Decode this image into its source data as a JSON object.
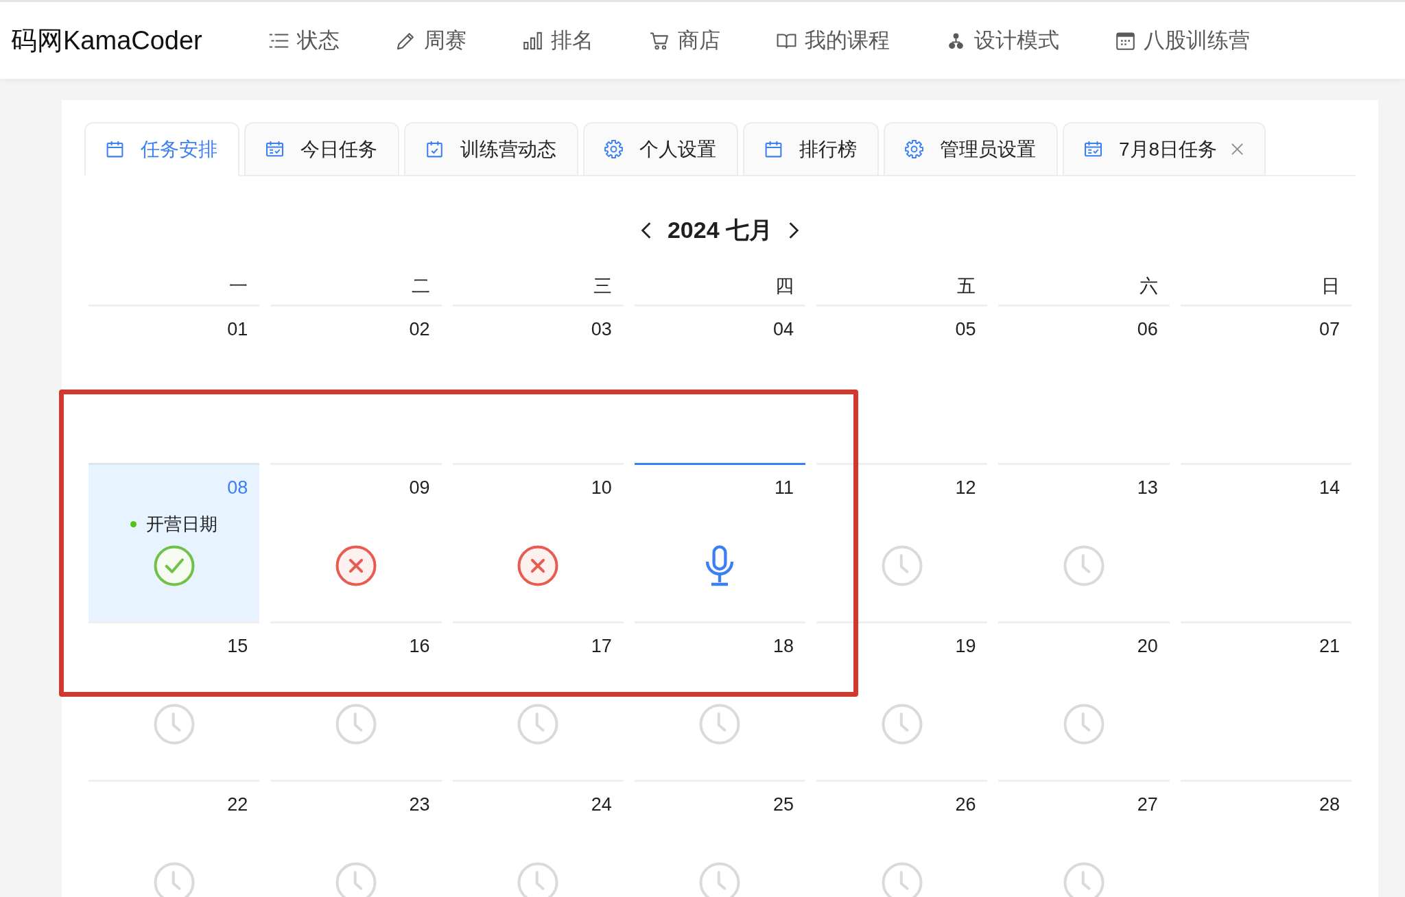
{
  "nav": {
    "logo": "码网KamaCoder",
    "items": [
      {
        "label": "状态",
        "kind": "list",
        "selected": false
      },
      {
        "label": "周赛",
        "kind": "edit",
        "selected": false
      },
      {
        "label": "排名",
        "kind": "chart",
        "selected": false
      },
      {
        "label": "商店",
        "kind": "cart",
        "selected": false
      },
      {
        "label": "我的课程",
        "kind": "book",
        "selected": false
      },
      {
        "label": "设计模式",
        "kind": "cluster",
        "selected": false
      },
      {
        "label": "八股训练营",
        "kind": "calendar",
        "selected": false
      }
    ]
  },
  "tabs": [
    {
      "label": "任务安排",
      "kind": "calendar",
      "selected": true,
      "closable": false
    },
    {
      "label": "今日任务",
      "kind": "schedule",
      "selected": false,
      "closable": false
    },
    {
      "label": "训练营动态",
      "kind": "check",
      "selected": false,
      "closable": false
    },
    {
      "label": "个人设置",
      "kind": "settings",
      "selected": false,
      "closable": false
    },
    {
      "label": "排行榜",
      "kind": "calendar",
      "selected": false,
      "closable": false
    },
    {
      "label": "管理员设置",
      "kind": "settings",
      "selected": false,
      "closable": false
    },
    {
      "label": "7月8日任务",
      "kind": "schedule",
      "selected": false,
      "closable": true
    }
  ],
  "calendar": {
    "title": "2024 七月",
    "weekdays": [
      "一",
      "二",
      "三",
      "四",
      "五",
      "六",
      "日"
    ],
    "weeks": [
      [
        {
          "day": "01",
          "selected": false
        },
        {
          "day": "02",
          "selected": false
        },
        {
          "day": "03",
          "selected": false
        },
        {
          "day": "04",
          "selected": false
        },
        {
          "day": "05",
          "selected": false
        },
        {
          "day": "06",
          "selected": false
        },
        {
          "day": "07",
          "selected": false
        }
      ],
      [
        {
          "day": "08",
          "selected": true,
          "kind": "done",
          "events": [
            {
              "text": "开营日期",
              "color": "#52c41a"
            }
          ]
        },
        {
          "day": "09",
          "selected": false,
          "kind": "missed"
        },
        {
          "day": "10",
          "selected": false,
          "kind": "missed"
        },
        {
          "day": "11",
          "selected": false,
          "kind": "current"
        },
        {
          "day": "12",
          "selected": false,
          "kind": "upcoming"
        },
        {
          "day": "13",
          "selected": false,
          "kind": "upcoming"
        },
        {
          "day": "14",
          "selected": false
        }
      ],
      [
        {
          "day": "15",
          "selected": false,
          "kind": "upcoming"
        },
        {
          "day": "16",
          "selected": false,
          "kind": "upcoming"
        },
        {
          "day": "17",
          "selected": false,
          "kind": "upcoming"
        },
        {
          "day": "18",
          "selected": false,
          "kind": "upcoming"
        },
        {
          "day": "19",
          "selected": false,
          "kind": "upcoming"
        },
        {
          "day": "20",
          "selected": false,
          "kind": "upcoming"
        },
        {
          "day": "21",
          "selected": false
        }
      ],
      [
        {
          "day": "22",
          "selected": false,
          "kind": "upcoming"
        },
        {
          "day": "23",
          "selected": false,
          "kind": "upcoming"
        },
        {
          "day": "24",
          "selected": false,
          "kind": "upcoming"
        },
        {
          "day": "25",
          "selected": false,
          "kind": "upcoming"
        },
        {
          "day": "26",
          "selected": false,
          "kind": "upcoming"
        },
        {
          "day": "27",
          "selected": false,
          "kind": "upcoming"
        },
        {
          "day": "28",
          "selected": false
        }
      ]
    ]
  }
}
